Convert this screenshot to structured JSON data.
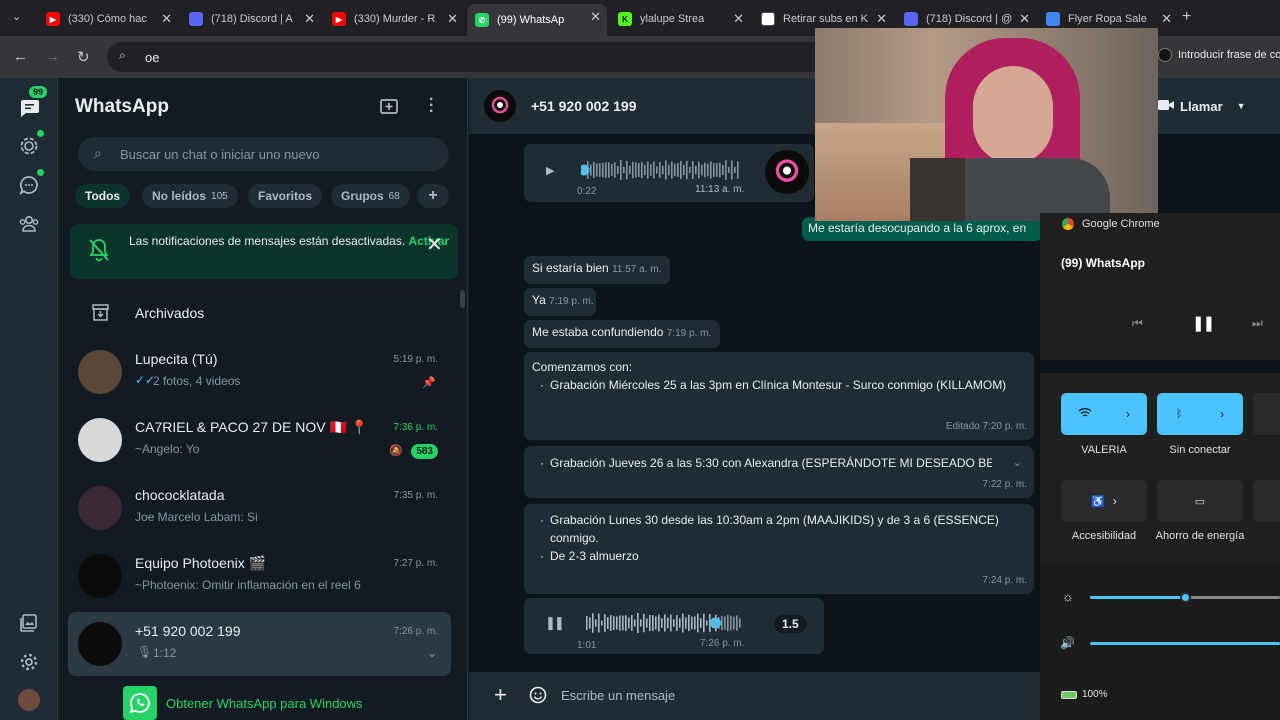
{
  "browser": {
    "tabs": [
      {
        "title": "(330) Cómo hac",
        "fav": "yt",
        "favcolor": "#ff0000"
      },
      {
        "title": "(718) Discord | A",
        "fav": "718",
        "favcolor": "#5865f2"
      },
      {
        "title": "(330) Murder - R",
        "fav": "yt",
        "favcolor": "#ff0000"
      },
      {
        "title": "(99) WhatsAp",
        "fav": "wa",
        "favcolor": "#25d366"
      },
      {
        "title": "ylalupe Strea",
        "fav": "K",
        "favcolor": "#53fc18"
      },
      {
        "title": "Retirar subs en K",
        "fav": "g",
        "favcolor": "#ffffff"
      },
      {
        "title": "(718) Discord | @",
        "fav": "718",
        "favcolor": "#5865f2"
      },
      {
        "title": "Flyer Ropa Sale",
        "fav": "g",
        "favcolor": "#4285f4"
      }
    ],
    "address": "oe",
    "passphrase_prompt": "Introducir frase de co"
  },
  "rail": {
    "badge": "99"
  },
  "sidebar": {
    "title": "WhatsApp",
    "search_placeholder": "Buscar un chat o iniciar uno nuevo",
    "filters": [
      {
        "label": "Todos",
        "count": ""
      },
      {
        "label": "No leídos",
        "count": "105"
      },
      {
        "label": "Favoritos",
        "count": ""
      },
      {
        "label": "Grupos",
        "count": "68"
      }
    ],
    "notification": {
      "text": "Las notificaciones de mensajes están desactivadas.",
      "action": "Activar"
    },
    "archived": "Archivados",
    "chats": [
      {
        "name": "Lupecita (Tú)",
        "preview": "2 fotos, 4 videos",
        "time": "5:19 p. m.",
        "unread": "",
        "avatar_color": "#5a4636",
        "time_green": false
      },
      {
        "name": "CA7RIEL & PACO 27 DE NOV 🇵🇪 📍",
        "preview": "~Angelo: Yo",
        "time": "7:36 p. m.",
        "unread": "583",
        "avatar_color": "#d8d8d8",
        "time_green": true
      },
      {
        "name": "chococklatada",
        "preview": "Joe Marcelo Labam: Si",
        "time": "7:35 p. m.",
        "unread": "",
        "avatar_color": "#3b2a35",
        "time_green": false
      },
      {
        "name": "Equipo Photoenix 🎬",
        "preview": "~Photoenix: Omitir inflamación en el reel 6",
        "time": "7:27 p. m.",
        "unread": "",
        "avatar_color": "#0b0b0b",
        "time_green": false
      },
      {
        "name": "+51 920 002 199",
        "preview": "1:12",
        "time": "7:26 p. m.",
        "unread": "",
        "avatar_color": "#0b0b0b",
        "time_green": false
      }
    ],
    "get_app": "Obtener WhatsApp para Windows"
  },
  "conversation": {
    "contact": "+51 920 002 199",
    "call_label": "Llamar",
    "audio1": {
      "elapsed": "0:22",
      "time": "11:13 a. m."
    },
    "outgoing_snippet": "Me estaría desocupando a la 6 aprox, en",
    "messages": [
      {
        "text": "Si estaría bien",
        "time": "11:57 a. m."
      },
      {
        "text": "Ya",
        "time": "7:19 p. m."
      },
      {
        "text": "Me estaba confundiendo",
        "time": "7:19 p. m."
      }
    ],
    "long_msg": {
      "intro": "Comenzamos con:",
      "item": "Grabación Miércoles 25 a las 3pm en Clínica Montesur - Surco conmigo (KILLAMOM)",
      "time": "Editado 7:20 p. m."
    },
    "msg2": {
      "item": "Grabación Jueves 26 a las 5:30 con Alexandra (ESPERÁNDOTE MI DESEADO BE",
      "time": "7:22 p. m."
    },
    "msg3": {
      "item": "Grabación Lunes 30 desde las 10:30am a 2pm (MAAJIKIDS) y de 3 a 6 (ESSENCE) conmigo.",
      "item2": "De 2-3 almuerzo",
      "time": "7:24 p. m."
    },
    "audio2": {
      "elapsed": "1:01",
      "time": "7:26 p. m.",
      "speed": "1.5"
    },
    "composer_placeholder": "Escribe un mensaje"
  },
  "quick_settings": {
    "media_source": "Google Chrome",
    "media_title": "(99) WhatsApp",
    "tiles": [
      {
        "label": "VALERIA",
        "on": true
      },
      {
        "label": "Sin conectar",
        "on": true
      },
      {
        "label": "Accesibilidad",
        "on": false
      },
      {
        "label": "Ahorro de energía",
        "on": false
      }
    ],
    "battery": "100%",
    "brightness": 0.5,
    "colors": {
      "accent": "#4cc2ff",
      "wa_green": "#25d366"
    }
  }
}
